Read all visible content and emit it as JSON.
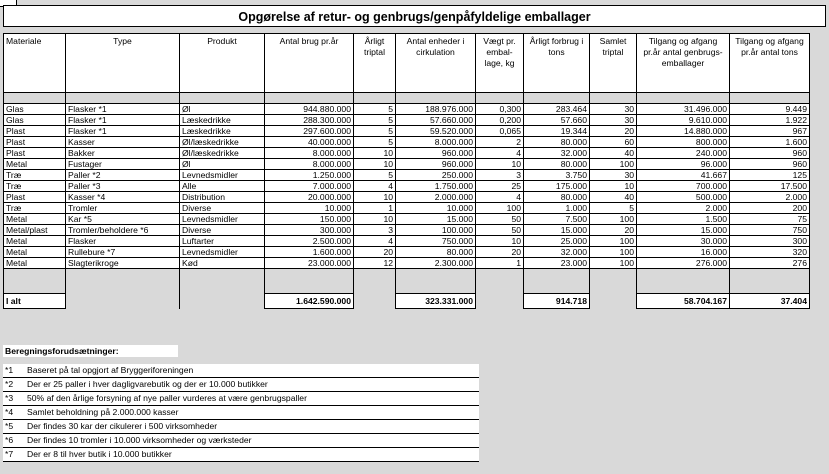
{
  "title": "Opgørelse af retur- og genbrugs/genpåfyldelige emballager",
  "columns": [
    "Materiale",
    "Type",
    "Produkt",
    "Antal brug pr.år",
    "Årligt triptal",
    "Antal enheder i cirkulation",
    "Vægt pr. embal-lage, kg",
    "Årligt forbrug i tons",
    "Samlet triptal",
    "Tilgang og afgang pr.år antal genbrugs-emballager",
    "Tilgang og afgang pr.år antal tons"
  ],
  "rows": [
    [
      "Glas",
      "Flasker *1",
      "Øl",
      "944.880.000",
      "5",
      "188.976.000",
      "0,300",
      "283.464",
      "30",
      "31.496.000",
      "9.449"
    ],
    [
      "Glas",
      "Flasker *1",
      "Læskedrikke",
      "288.300.000",
      "5",
      "57.660.000",
      "0,200",
      "57.660",
      "30",
      "9.610.000",
      "1.922"
    ],
    [
      "Plast",
      "Flasker *1",
      "Læskedrikke",
      "297.600.000",
      "5",
      "59.520.000",
      "0,065",
      "19.344",
      "20",
      "14.880.000",
      "967"
    ],
    [
      "Plast",
      "Kasser",
      "Øl/læskedrikke",
      "40.000.000",
      "5",
      "8.000.000",
      "2",
      "80.000",
      "60",
      "800.000",
      "1.600"
    ],
    [
      "Plast",
      "Bakker",
      "Øl/læskedrikke",
      "8.000.000",
      "10",
      "960.000",
      "4",
      "32.000",
      "40",
      "240.000",
      "960"
    ],
    [
      "Metal",
      "Fustager",
      "Øl",
      "8.000.000",
      "10",
      "960.000",
      "10",
      "80.000",
      "100",
      "96.000",
      "960"
    ],
    [
      "Træ",
      "Paller *2",
      "Levnedsmidler",
      "1.250.000",
      "5",
      "250.000",
      "3",
      "3.750",
      "30",
      "41.667",
      "125"
    ],
    [
      "Træ",
      "Paller *3",
      "Alle",
      "7.000.000",
      "4",
      "1.750.000",
      "25",
      "175.000",
      "10",
      "700.000",
      "17.500"
    ],
    [
      "Plast",
      "Kasser *4",
      "Distribution",
      "20.000.000",
      "10",
      "2.000.000",
      "4",
      "80.000",
      "40",
      "500.000",
      "2.000"
    ],
    [
      "Træ",
      "Tromler",
      "Diverse",
      "10.000",
      "1",
      "10.000",
      "100",
      "1.000",
      "5",
      "2.000",
      "200"
    ],
    [
      "Metal",
      "Kar *5",
      "Levnedsmidler",
      "150.000",
      "10",
      "15.000",
      "50",
      "7.500",
      "100",
      "1.500",
      "75"
    ],
    [
      "Metal/plast",
      "Tromler/beholdere *6",
      "Diverse",
      "300.000",
      "3",
      "100.000",
      "50",
      "15.000",
      "20",
      "15.000",
      "750"
    ],
    [
      "Metal",
      "Flasker",
      "Luftarter",
      "2.500.000",
      "4",
      "750.000",
      "10",
      "25.000",
      "100",
      "30.000",
      "300"
    ],
    [
      "Metal",
      "Rullebure *7",
      "Levnedsmidler",
      "1.600.000",
      "20",
      "80.000",
      "20",
      "32.000",
      "100",
      "16.000",
      "320"
    ],
    [
      "Metal",
      "Slagterikroge",
      "Kød",
      "23.000.000",
      "12",
      "2.300.000",
      "1",
      "23.000",
      "100",
      "276.000",
      "276"
    ]
  ],
  "totals": {
    "label": "I alt",
    "antal_brug": "1.642.590.000",
    "antal_enheder": "323.331.000",
    "forbrug_tons": "914.718",
    "tilgang_antal": "58.704.167",
    "tilgang_tons": "37.404"
  },
  "assumptions_title": "Beregningsforudsætninger:",
  "notes": [
    {
      "key": "*1",
      "text": "Baseret på tal opgjort af Bryggeriforeningen"
    },
    {
      "key": "*2",
      "text": "Der er 25 paller i hver dagligvarebutik og der er 10.000 butikker"
    },
    {
      "key": "*3",
      "text": "50% af den årlige forsyning af nye paller vurderes at være genbrugspaller"
    },
    {
      "key": "*4",
      "text": "Samlet beholdning på 2.000.000 kasser"
    },
    {
      "key": "*5",
      "text": "Der findes 30 kar der cikulerer i 500 virksomheder"
    },
    {
      "key": "*6",
      "text": "Der findes 10 tromler i 10.000 virksomheder og værksteder"
    },
    {
      "key": "*7",
      "text": "Der er 8 til hver butik i 10.000 butikker"
    }
  ]
}
